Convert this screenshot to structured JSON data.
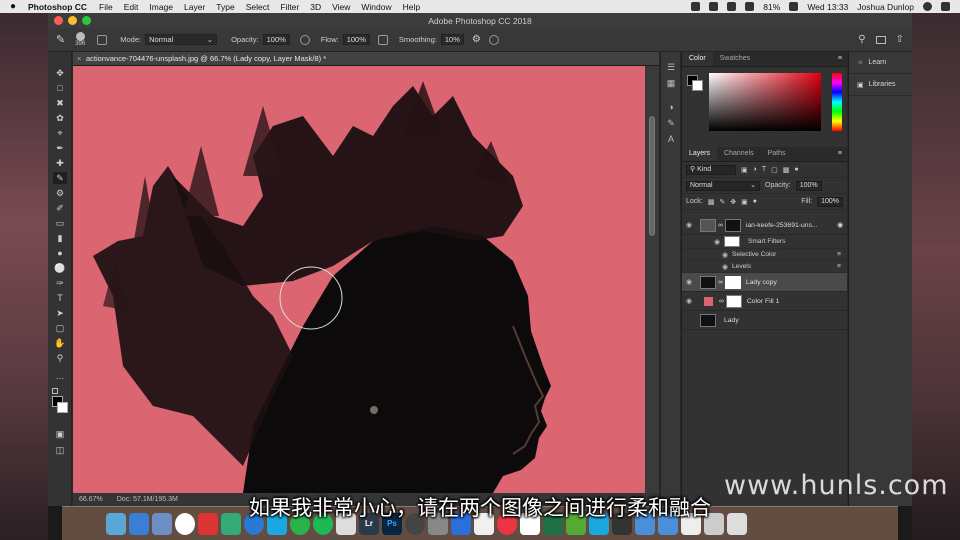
{
  "menubar": {
    "app_name": "Photoshop CC",
    "items": [
      "File",
      "Edit",
      "Image",
      "Layer",
      "Type",
      "Select",
      "Filter",
      "3D",
      "View",
      "Window",
      "Help"
    ],
    "battery": "81%",
    "clock": "Wed 13:33",
    "user": "Joshua Dunlop"
  },
  "window": {
    "title": "Adobe Photoshop CC 2018"
  },
  "options_bar": {
    "brush_size": "396",
    "mode_label": "Mode:",
    "mode_value": "Normal",
    "opacity_label": "Opacity:",
    "opacity_value": "100%",
    "flow_label": "Flow:",
    "flow_value": "100%",
    "smoothing_label": "Smoothing:",
    "smoothing_value": "10%"
  },
  "document": {
    "tab_title": "actionvance-704476-unsplash.jpg @ 66.7% (Lady copy, Layer Mask/8) *",
    "zoom": "66.67%",
    "doc_size": "Doc: 57.1M/195.3M",
    "background_color": "#dc6572"
  },
  "color_panel": {
    "tabs": [
      "Color",
      "Swatches"
    ],
    "active_tab": "Color",
    "foreground": "#000000",
    "background": "#ffffff"
  },
  "layers_panel": {
    "tabs": [
      "Layers",
      "Channels",
      "Paths"
    ],
    "active_tab": "Layers",
    "filter_kind": "Kind",
    "blend_mode": "Normal",
    "opacity_label": "Opacity:",
    "opacity_value": "100%",
    "lock_label": "Lock:",
    "fill_label": "Fill:",
    "fill_value": "100%",
    "layers": [
      {
        "name": "ian-keefe-253691-uns...",
        "visible": true,
        "selected": false
      },
      {
        "name": "Smart Filters",
        "visible": true,
        "sublayer": true
      },
      {
        "name": "Selective Color",
        "visible": true,
        "sublayer": true
      },
      {
        "name": "Levels",
        "visible": true,
        "sublayer": true
      },
      {
        "name": "Lady copy",
        "visible": true,
        "selected": true
      },
      {
        "name": "Color Fill 1",
        "visible": true,
        "selected": false
      },
      {
        "name": "Lady",
        "visible": false,
        "selected": false
      }
    ]
  },
  "right_dock": {
    "learn": "Learn",
    "libraries": "Libraries"
  },
  "overlay": {
    "subtitle": "如果我非常小心，请在两个图像之间进行柔和融合",
    "watermark": "www.hunls.com"
  },
  "dock_apps": [
    "Ps",
    "Lr"
  ]
}
